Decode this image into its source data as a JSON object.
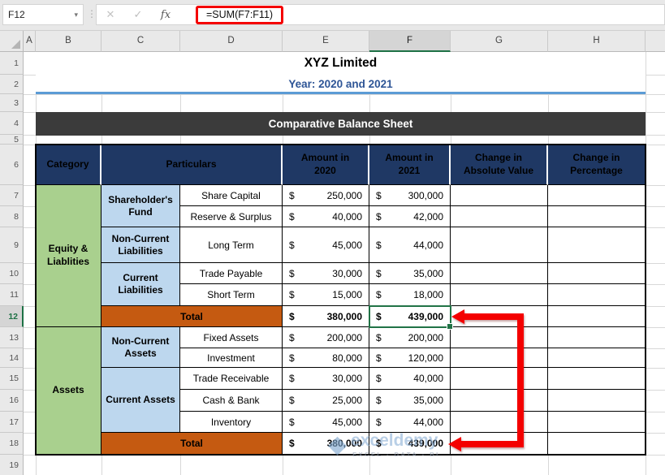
{
  "formula_bar": {
    "name_box_value": "F12",
    "formula": "=SUM(F7:F11)"
  },
  "icons": {
    "dropdown": "▾",
    "separator": "⋮",
    "cancel": "✕",
    "enter": "✓",
    "fx": "fx",
    "watermark_logo": "◆"
  },
  "grid": {
    "column_letters": [
      "A",
      "B",
      "C",
      "D",
      "E",
      "F",
      "G",
      "H"
    ],
    "row_numbers": [
      "1",
      "2",
      "3",
      "4",
      "5",
      "6",
      "7",
      "8",
      "9",
      "10",
      "11",
      "12",
      "13",
      "14",
      "15",
      "16",
      "17",
      "18",
      "19"
    ],
    "selected_cell": "F12",
    "selected_column": "F",
    "selected_row": "12"
  },
  "titles": {
    "company": "XYZ Limited",
    "period": "Year: 2020 and 2021",
    "sheet": "Comparative Balance Sheet"
  },
  "table": {
    "currency": "$",
    "headers": {
      "category": "Category",
      "particulars": "Particulars",
      "amount_2020": "Amount in 2020",
      "amount_2021": "Amount in 2021",
      "change_abs": "Change in Absolute Value",
      "change_pct": "Change in Percentage"
    },
    "equity": {
      "category": "Equity & Liablities",
      "shareholders_fund": {
        "name": "Shareholder's Fund",
        "share_capital": {
          "label": "Share Capital",
          "y2020": "250,000",
          "y2021": "300,000"
        },
        "reserve_surplus": {
          "label": "Reserve & Surplus",
          "y2020": "40,000",
          "y2021": "42,000"
        }
      },
      "non_current_liabilities": {
        "name": "Non-Current Liabilities",
        "long_term": {
          "label": "Long Term",
          "y2020": "45,000",
          "y2021": "44,000"
        }
      },
      "current_liabilities": {
        "name": "Current Liabilities",
        "trade_payable": {
          "label": "Trade Payable",
          "y2020": "30,000",
          "y2021": "35,000"
        },
        "short_term": {
          "label": "Short Term",
          "y2020": "15,000",
          "y2021": "18,000"
        }
      },
      "total": {
        "label": "Total",
        "y2020": "380,000",
        "y2021": "439,000"
      }
    },
    "assets": {
      "category": "Assets",
      "non_current_assets": {
        "name": "Non-Current Assets",
        "fixed_assets": {
          "label": "Fixed Assets",
          "y2020": "200,000",
          "y2021": "200,000"
        },
        "investment": {
          "label": "Investment",
          "y2020": "80,000",
          "y2021": "120,000"
        }
      },
      "current_assets": {
        "name": "Current Assets",
        "trade_receivable": {
          "label": "Trade Receivable",
          "y2020": "30,000",
          "y2021": "40,000"
        },
        "cash_bank": {
          "label": "Cash & Bank",
          "y2020": "25,000",
          "y2021": "35,000"
        },
        "inventory": {
          "label": "Inventory",
          "y2020": "45,000",
          "y2021": "44,000"
        }
      },
      "total": {
        "label": "Total",
        "y2020": "380,000",
        "y2021": "439,000"
      }
    }
  },
  "watermark": {
    "brand": "exceldemy",
    "tagline": "EXCEL - DATA - BI"
  },
  "colors": {
    "header_navy": "#1F3864",
    "category_green": "#A9D08E",
    "group_blue": "#BDD7EE",
    "total_orange": "#C55A11",
    "title_blue": "#2E5596",
    "divider_blue": "#5B9BD5",
    "band_dark": "#3B3B3B",
    "arrow_red": "#F40000",
    "selection_green": "#217346"
  }
}
